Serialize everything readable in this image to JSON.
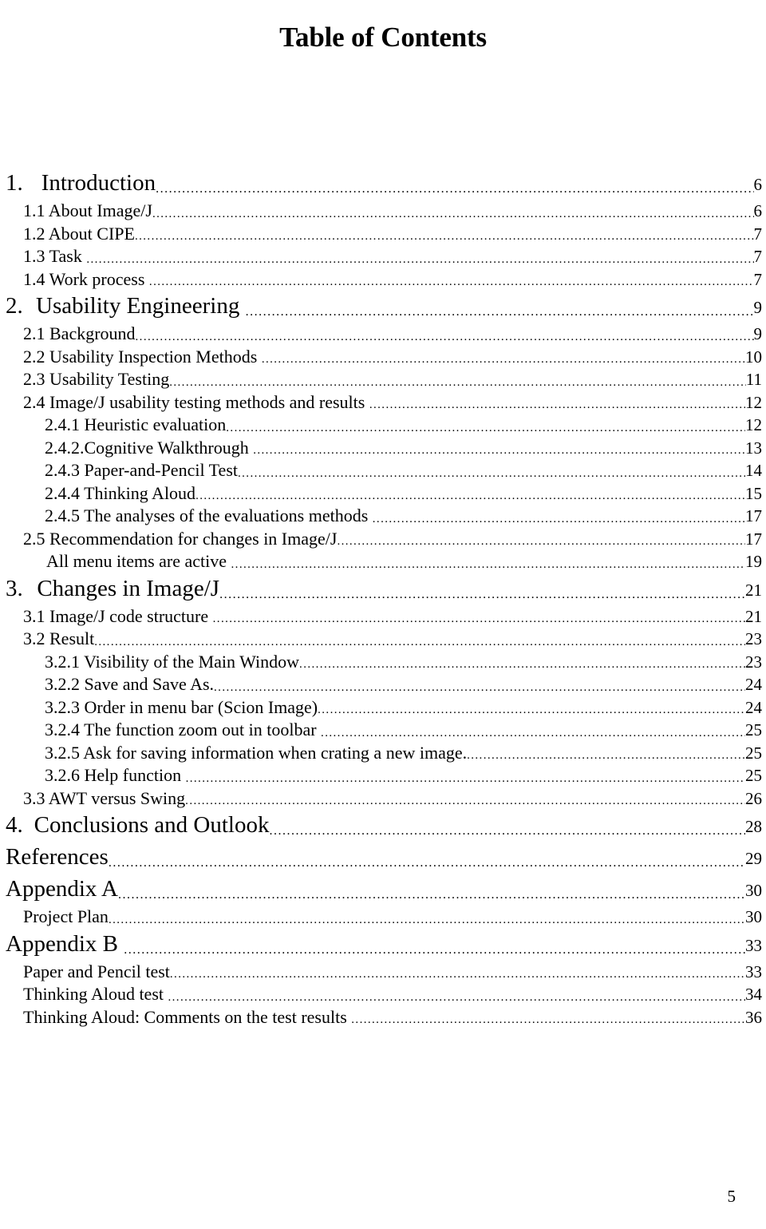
{
  "document": {
    "title": "Table of Contents",
    "footer_page_number": "5"
  },
  "toc": {
    "entries": [
      {
        "level": 1,
        "number": "1.",
        "label": "Introduction",
        "page": "6"
      },
      {
        "level": 2,
        "number": "",
        "label": "1.1 About Image/J",
        "page": "6"
      },
      {
        "level": 2,
        "number": "",
        "label": "1.2 About CIPE",
        "page": "7"
      },
      {
        "level": 2,
        "number": "",
        "label": "1.3 Task ",
        "page": "7"
      },
      {
        "level": 2,
        "number": "",
        "label": "1.4 Work process ",
        "page": "7"
      },
      {
        "level": 1,
        "number": "2.",
        "label": "Usability Engineering ",
        "page": "9"
      },
      {
        "level": 2,
        "number": "",
        "label": "2.1 Background",
        "page": "9"
      },
      {
        "level": 2,
        "number": "",
        "label": "2.2 Usability Inspection Methods ",
        "page": "10"
      },
      {
        "level": 2,
        "number": "",
        "label": "2.3 Usability Testing",
        "page": "11"
      },
      {
        "level": 2,
        "number": "",
        "label": "2.4 Image/J usability testing methods and results ",
        "page": "12"
      },
      {
        "level": 3,
        "number": "",
        "label": "2.4.1 Heuristic evaluation",
        "page": "12"
      },
      {
        "level": 3,
        "number": "",
        "label": "2.4.2.Cognitive Walkthrough ",
        "page": "13"
      },
      {
        "level": 3,
        "number": "",
        "label": "2.4.3 Paper-and-Pencil Test",
        "page": "14"
      },
      {
        "level": 3,
        "number": "",
        "label": "2.4.4 Thinking Aloud",
        "page": "15"
      },
      {
        "level": 3,
        "number": "",
        "label": "2.4.5 The analyses of the evaluations methods ",
        "page": "17"
      },
      {
        "level": 2,
        "number": "",
        "label": "2.5 Recommendation for changes in Image/J",
        "page": "17"
      },
      {
        "level": 2,
        "number": "",
        "label": "All menu items are active ",
        "page": "19",
        "deep": true
      },
      {
        "level": 1,
        "number": "3.",
        "label": "Changes in Image/J",
        "page": "21"
      },
      {
        "level": 2,
        "number": "",
        "label": "3.1 Image/J code structure ",
        "page": "21"
      },
      {
        "level": 2,
        "number": "",
        "label": "3.2 Result",
        "page": "23"
      },
      {
        "level": 3,
        "number": "",
        "label": "3.2.1 Visibility of the Main Window",
        "page": "23"
      },
      {
        "level": 3,
        "number": "",
        "label": "3.2.2 Save and Save As.",
        "page": "24"
      },
      {
        "level": 3,
        "number": "",
        "label": "3.2.3 Order in menu bar (Scion Image)",
        "page": "24"
      },
      {
        "level": 3,
        "number": "",
        "label": "3.2.4 The function zoom out in toolbar ",
        "page": "25"
      },
      {
        "level": 3,
        "number": "",
        "label": "3.2.5 Ask for saving information when crating a new image.",
        "page": "25"
      },
      {
        "level": 3,
        "number": "",
        "label": "3.2.6 Help function ",
        "page": "25"
      },
      {
        "level": 2,
        "number": "",
        "label": "3.3 AWT versus Swing",
        "page": "26"
      },
      {
        "level": 1,
        "number": "4.",
        "label": "Conclusions and Outlook",
        "page": "28"
      },
      {
        "level": 1,
        "number": "",
        "label": "References",
        "page": "29"
      },
      {
        "level": 1,
        "number": "",
        "label": "Appendix A",
        "page": "30"
      },
      {
        "level": 2,
        "number": "",
        "label": "Project Plan",
        "page": "30"
      },
      {
        "level": 1,
        "number": "",
        "label": "Appendix B ",
        "page": "33"
      },
      {
        "level": 2,
        "number": "",
        "label": "Paper and Pencil test",
        "page": "33"
      },
      {
        "level": 2,
        "number": "",
        "label": "Thinking Aloud test ",
        "page": "34"
      },
      {
        "level": 2,
        "number": "",
        "label": "Thinking Aloud: Comments on the test results ",
        "page": "36"
      }
    ]
  }
}
